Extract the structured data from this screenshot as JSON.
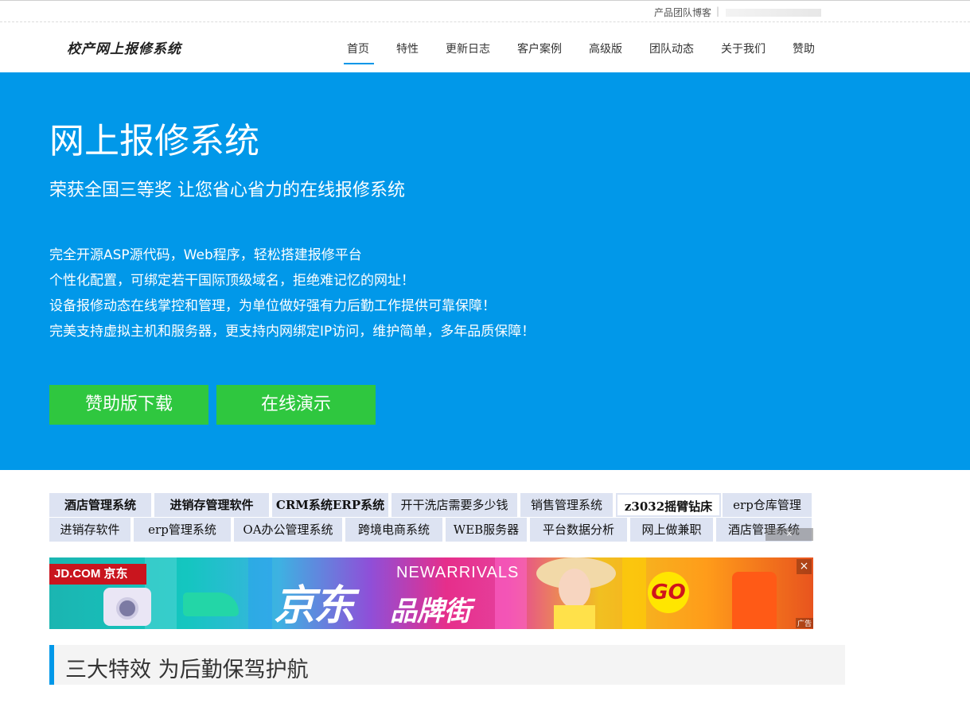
{
  "topbar": {
    "blog_link": "产品团队博客",
    "separator": "|"
  },
  "header": {
    "logo": "校产网上报修系统"
  },
  "nav": [
    {
      "label": "首页",
      "active": true
    },
    {
      "label": "特性"
    },
    {
      "label": "更新日志"
    },
    {
      "label": "客户案例"
    },
    {
      "label": "高级版"
    },
    {
      "label": "团队动态"
    },
    {
      "label": "关于我们"
    },
    {
      "label": "赞助"
    }
  ],
  "hero": {
    "title": "网上报修系统",
    "subtitle": "荣获全国三等奖 让您省心省力的在线报修系统",
    "lines": [
      "完全开源ASP源代码，Web程序，轻松搭建报修平台",
      "个性化配置，可绑定若干国际顶级域名，拒绝难记忆的网址！",
      "设备报修动态在线掌控和管理，为单位做好强有力后勤工作提供可靠保障！",
      "完美支持虚拟主机和服务器，更支持内网绑定IP访问，维护简单，多年品质保障！"
    ],
    "buttons": {
      "download": "赞助版下载",
      "demo": "在线演示"
    },
    "colors": {
      "background": "#0198e9",
      "button": "#2fc73f"
    }
  },
  "adlinks": {
    "row1": [
      "酒店管理系统",
      "进销存管理软件",
      "CRM系统ERP系统",
      "开干洗店需要多少钱",
      "销售管理系统",
      "z3032摇臂钻床",
      "erp仓库管理"
    ],
    "row2": [
      "进销存软件",
      "erp管理系统",
      "OA办公管理系统",
      "跨境电商系统",
      "WEB服务器",
      "平台数据分析",
      "网上做兼职",
      "酒店管理系统"
    ],
    "close_label": "×"
  },
  "banner": {
    "jd_tag": "JD.COM 京东",
    "headline": "京东",
    "brand_street": "品牌街",
    "new_arrivals": "NEWARRIVALS",
    "go": "GO",
    "close": "×",
    "ad_label": "广告"
  },
  "section": {
    "title": "三大特效 为后勤保驾护航"
  }
}
